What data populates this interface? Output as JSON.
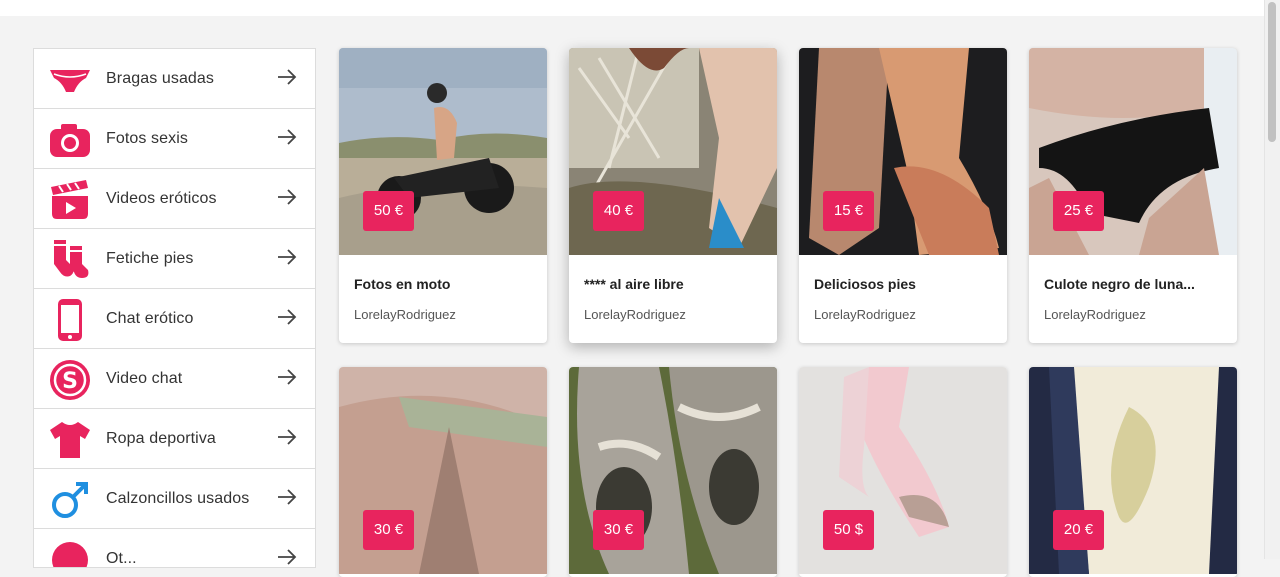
{
  "brand_color": "#e8245e",
  "sidebar": {
    "items": [
      {
        "label": "Bragas usadas",
        "icon": "panties-icon"
      },
      {
        "label": "Fotos sexis",
        "icon": "camera-icon"
      },
      {
        "label": "Videos eróticos",
        "icon": "clapperboard-icon"
      },
      {
        "label": "Fetiche pies",
        "icon": "socks-icon"
      },
      {
        "label": "Chat erótico",
        "icon": "smartphone-icon"
      },
      {
        "label": "Video chat",
        "icon": "skype-icon"
      },
      {
        "label": "Ropa deportiva",
        "icon": "tshirt-icon"
      },
      {
        "label": "Calzoncillos usados",
        "icon": "male-symbol-icon"
      },
      {
        "label": "Ot...",
        "icon": "more-icon"
      }
    ],
    "arrow_icon": "arrow-right-icon"
  },
  "products": [
    {
      "price": "50 €",
      "title": "Fotos en moto",
      "seller": "LorelayRodriguez"
    },
    {
      "price": "40 €",
      "title": "**** al aire libre",
      "seller": "LorelayRodriguez"
    },
    {
      "price": "15 €",
      "title": "Deliciosos pies",
      "seller": "LorelayRodriguez"
    },
    {
      "price": "25 €",
      "title": "Culote negro de luna...",
      "seller": "LorelayRodriguez"
    },
    {
      "price": "30 €",
      "title": "",
      "seller": ""
    },
    {
      "price": "30 €",
      "title": "",
      "seller": ""
    },
    {
      "price": "50 $",
      "title": "",
      "seller": ""
    },
    {
      "price": "20 €",
      "title": "",
      "seller": ""
    }
  ]
}
